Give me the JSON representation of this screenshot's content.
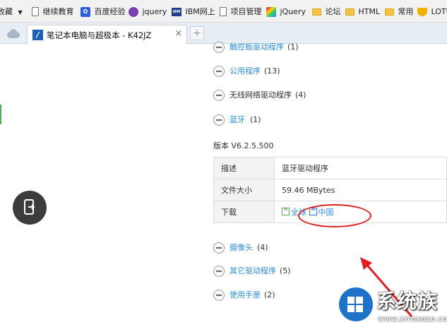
{
  "bookmarks": [
    {
      "label": "收藏",
      "icon": "dropdown-icon"
    },
    {
      "label": "继续教育",
      "icon": "page-icon"
    },
    {
      "label": "百度经验",
      "icon": "baidu-paw-icon"
    },
    {
      "label": "jquery",
      "icon": "gear-icon"
    },
    {
      "label": "IBM网上",
      "icon": "ibm-icon"
    },
    {
      "label": "项目管理",
      "icon": "page-icon"
    },
    {
      "label": "jQuery",
      "icon": "jquery-icon"
    },
    {
      "label": "论坛",
      "icon": "folder-icon"
    },
    {
      "label": "HTML",
      "icon": "folder-icon"
    },
    {
      "label": "常用",
      "icon": "folder-icon"
    },
    {
      "label": "LOTU",
      "icon": "lotus-icon"
    }
  ],
  "tab": {
    "title": "笔记本电脑与超极本 - K42JZ",
    "close": "×",
    "new_tab": "+"
  },
  "categories_top": [
    {
      "label": "触控板驱动程序",
      "count": "(1)"
    },
    {
      "label": "公用程序",
      "count": "(13)"
    },
    {
      "label": "无线网络驱动程序",
      "count": "(4)"
    },
    {
      "label": "蓝牙",
      "count": "(1)"
    }
  ],
  "version": "版本 V6.2.5.500",
  "details": {
    "desc_key": "描述",
    "desc_val": "蓝牙驱动程序",
    "size_key": "文件大小",
    "size_val": "59.46 MBytes",
    "download_key": "下载",
    "download_global": "全球",
    "download_china": "中国"
  },
  "categories_bottom": [
    {
      "label": "摄像头",
      "count": "(4)"
    },
    {
      "label": "其它驱动程序",
      "count": "(5)"
    },
    {
      "label": "使用手册",
      "count": "(2)"
    }
  ],
  "watermark": {
    "brand": "系统族",
    "url": "WWW.XITONGZU.COM"
  },
  "colors": {
    "link": "#2a8fd8",
    "annotation": "#e02020",
    "fab": "#3c3c3c"
  }
}
